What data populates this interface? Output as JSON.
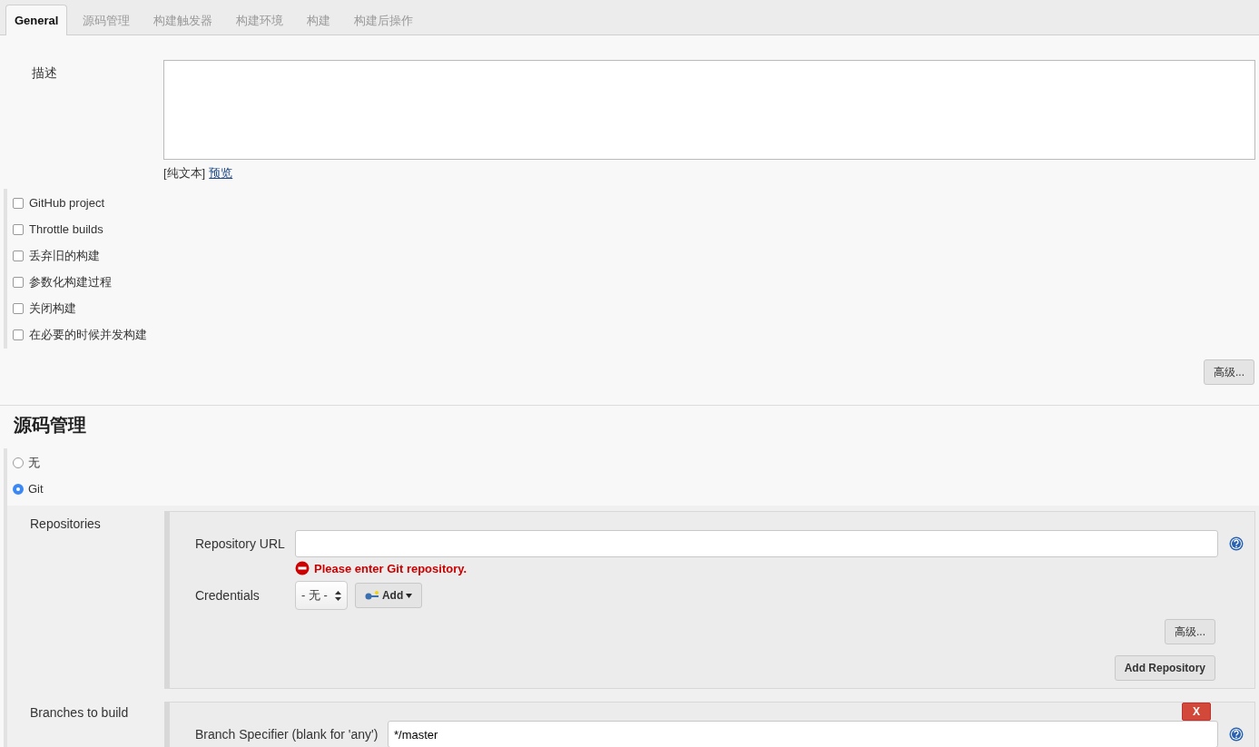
{
  "tabs": [
    {
      "label": "General",
      "selected": true
    },
    {
      "label": "源码管理",
      "selected": false
    },
    {
      "label": "构建触发器",
      "selected": false
    },
    {
      "label": "构建环境",
      "selected": false
    },
    {
      "label": "构建",
      "selected": false
    },
    {
      "label": "构建后操作",
      "selected": false
    }
  ],
  "general": {
    "description_label": "描述",
    "format_label": "[纯文本]",
    "preview_link": "预览",
    "options": [
      {
        "label": "GitHub project",
        "checked": false
      },
      {
        "label": "Throttle builds",
        "checked": false
      },
      {
        "label": "丢弃旧的构建",
        "checked": false
      },
      {
        "label": "参数化构建过程",
        "checked": false
      },
      {
        "label": "关闭构建",
        "checked": false
      },
      {
        "label": "在必要的时候并发构建",
        "checked": false
      }
    ],
    "advanced_button": "高级..."
  },
  "scm": {
    "heading": "源码管理",
    "choices": [
      {
        "label": "无",
        "selected": false
      },
      {
        "label": "Git",
        "selected": true
      }
    ],
    "repositories_label": "Repositories",
    "repository_url_label": "Repository URL",
    "repository_url_error": "Please enter Git repository.",
    "credentials_label": "Credentials",
    "credentials_value": "- 无 -",
    "add_button": "Add",
    "advanced_button": "高级...",
    "add_repository_button": "Add Repository",
    "branches_label": "Branches to build",
    "delete_button": "X",
    "branch_specifier_label": "Branch Specifier (blank for 'any')",
    "branch_specifier_value": "*/master"
  }
}
